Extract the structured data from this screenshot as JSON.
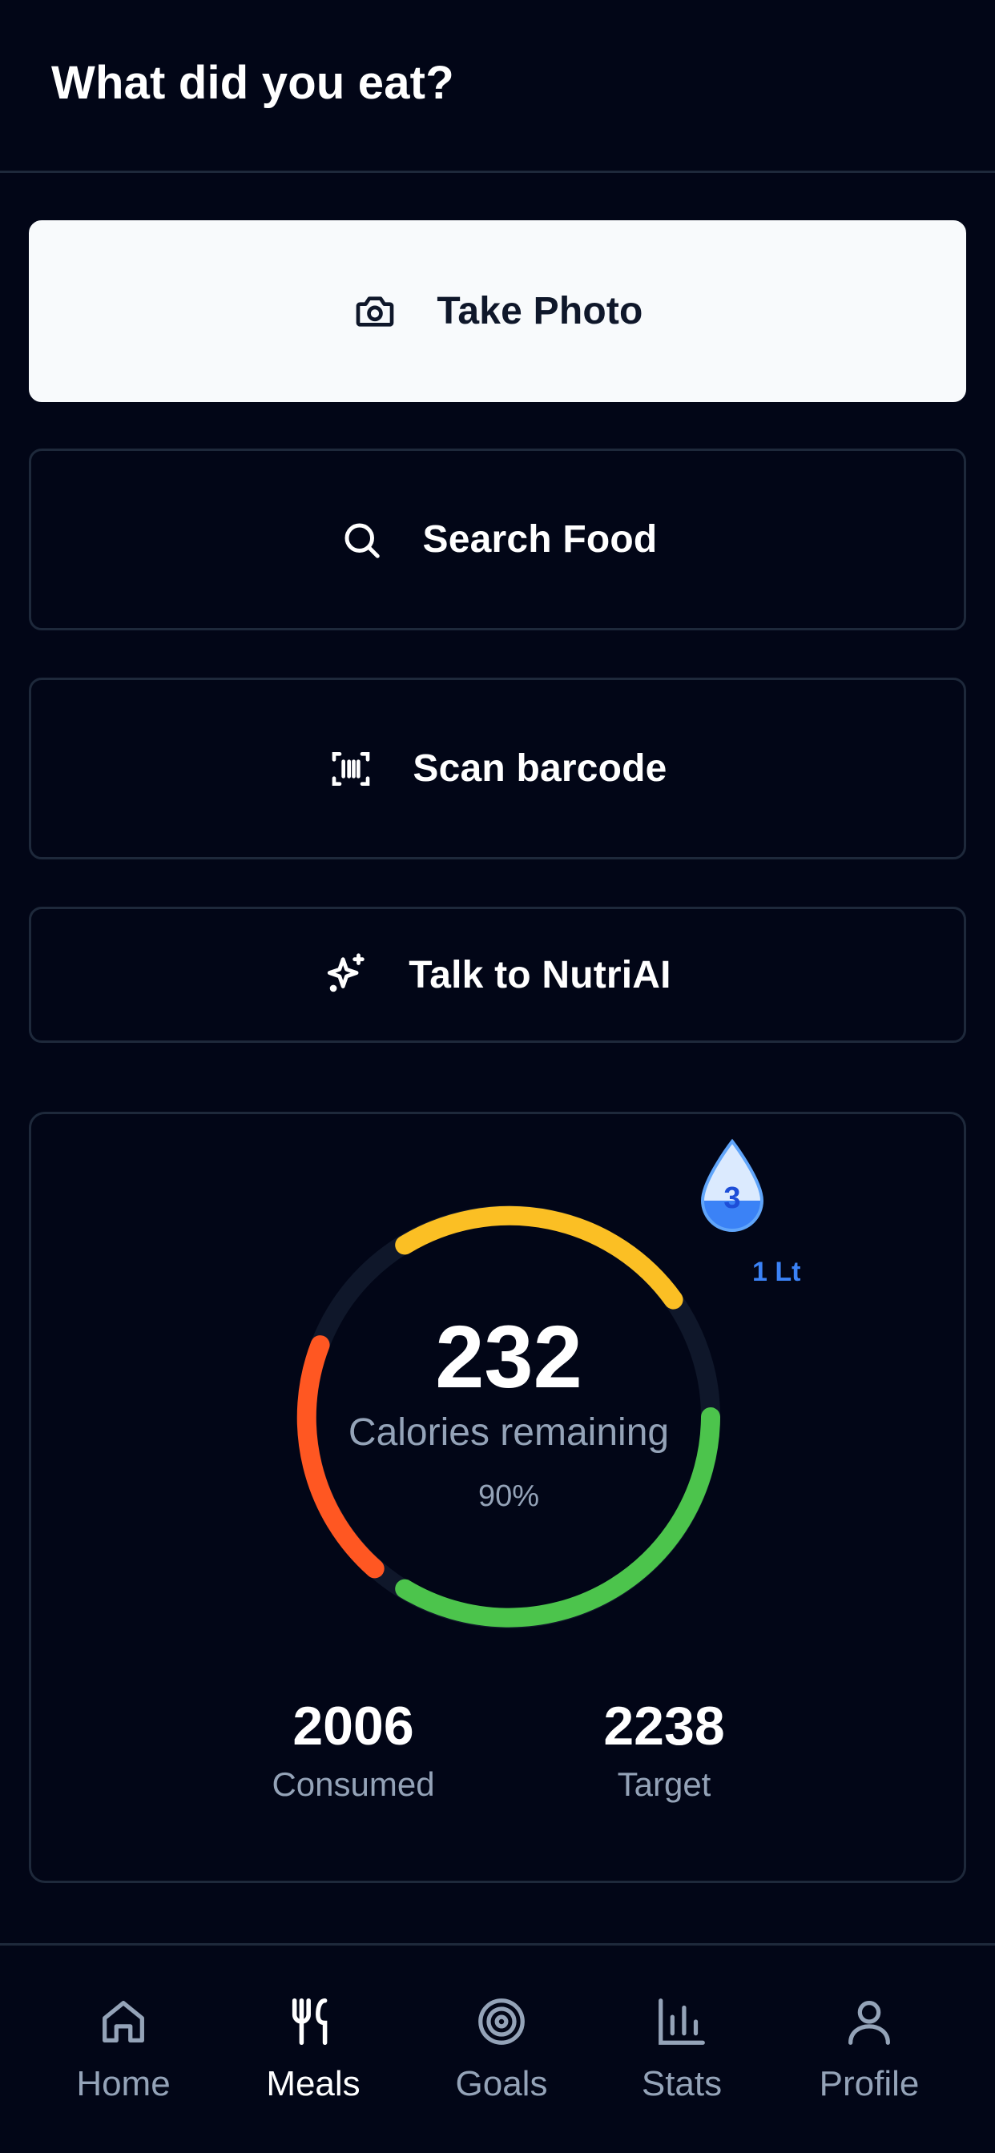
{
  "header": {
    "title": "What did you eat?"
  },
  "actions": {
    "photo": {
      "label": "Take Photo",
      "icon": "camera-icon"
    },
    "search": {
      "label": "Search Food",
      "icon": "search-icon"
    },
    "scan": {
      "label": "Scan barcode",
      "icon": "barcode-scan-icon"
    },
    "ai": {
      "label": "Talk to NutriAI",
      "icon": "sparkles-icon"
    }
  },
  "calories": {
    "remaining": "232",
    "remaining_label": "Calories remaining",
    "percent": "90%",
    "consumed": "2006",
    "consumed_label": "Consumed",
    "target": "2238",
    "target_label": "Target"
  },
  "water": {
    "glasses": "3",
    "amount": "1 Lt",
    "icon": "water-drop-icon"
  },
  "nav": {
    "items": [
      {
        "label": "Home",
        "icon": "home-icon",
        "active": false
      },
      {
        "label": "Meals",
        "icon": "utensils-icon",
        "active": true
      },
      {
        "label": "Goals",
        "icon": "target-icon",
        "active": false
      },
      {
        "label": "Stats",
        "icon": "bar-chart-icon",
        "active": false
      },
      {
        "label": "Profile",
        "icon": "user-icon",
        "active": false
      }
    ]
  },
  "colors": {
    "background": "#020617",
    "border": "#1e293b",
    "ring_orange": "#fbbf24",
    "ring_red": "#ff5722",
    "ring_green": "#4cc44c",
    "ring_track": "#0f172a",
    "water_blue": "#3b82f6",
    "muted_text": "#94a3b8"
  }
}
